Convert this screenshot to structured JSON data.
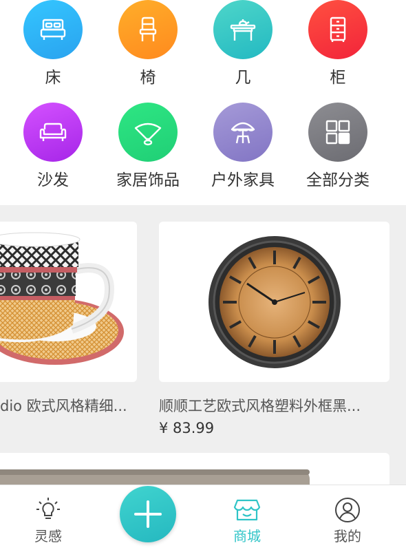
{
  "categories": [
    {
      "label": "床",
      "icon": "bed-icon"
    },
    {
      "label": "椅",
      "icon": "chair-icon"
    },
    {
      "label": "几",
      "icon": "tea-table-icon"
    },
    {
      "label": "柜",
      "icon": "cabinet-icon"
    },
    {
      "label": "沙发",
      "icon": "sofa-icon"
    },
    {
      "label": "家居饰品",
      "icon": "fan-decor-icon"
    },
    {
      "label": "户外家具",
      "icon": "patio-umbrella-icon"
    },
    {
      "label": "全部分类",
      "icon": "grid-icon"
    }
  ],
  "products": [
    {
      "title": "dio 欧式风格精细...",
      "price": ""
    },
    {
      "title": "顺顺工艺欧式风格塑料外框黑...",
      "price": "¥ 83.99"
    }
  ],
  "tabbar": {
    "items": [
      {
        "label": "灵感",
        "icon": "lightbulb-icon"
      },
      {
        "label": "",
        "icon": "plus-icon"
      },
      {
        "label": "商城",
        "icon": "store-icon"
      },
      {
        "label": "我的",
        "icon": "user-icon"
      }
    ],
    "active": "商城",
    "accent": "#2ec4c7"
  }
}
